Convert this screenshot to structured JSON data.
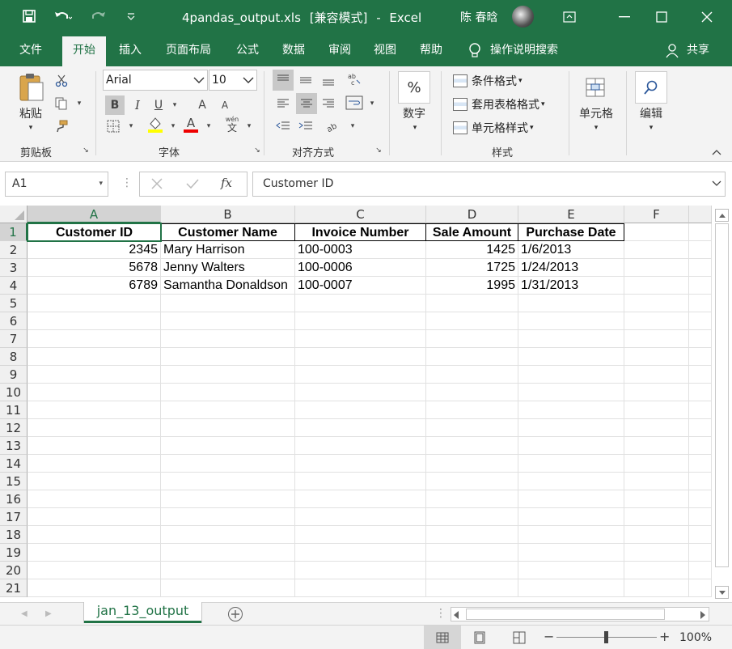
{
  "titlebar": {
    "filename": "4pandas_output.xls",
    "mode": "[兼容模式]",
    "app": "Excel",
    "separator": "-",
    "user": "陈 春晗"
  },
  "tabs": [
    "文件",
    "开始",
    "插入",
    "页面布局",
    "公式",
    "数据",
    "审阅",
    "视图",
    "帮助"
  ],
  "active_tab": "开始",
  "tell_me": "操作说明搜索",
  "share": "共享",
  "ribbon": {
    "clipboard": {
      "paste": "粘贴",
      "label": "剪贴板"
    },
    "font": {
      "name": "Arial",
      "size": "10",
      "label": "字体",
      "bold": "B",
      "italic": "I",
      "underline": "U",
      "grow": "A",
      "shrink": "A",
      "font_color_letter": "A",
      "phonetic": "wén"
    },
    "alignment": {
      "label": "对齐方式"
    },
    "number": {
      "pct": "%",
      "label": "数字"
    },
    "styles": {
      "conditional": "条件格式",
      "table": "套用表格格式",
      "cell": "单元格样式",
      "label": "样式"
    },
    "cells": {
      "label": "单元格"
    },
    "editing": {
      "label": "编辑"
    }
  },
  "formula_bar": {
    "name_box": "A1",
    "content": "Customer ID",
    "fx": "fx"
  },
  "columns": [
    "A",
    "B",
    "C",
    "D",
    "E",
    "F"
  ],
  "rows": [
    "1",
    "2",
    "3",
    "4",
    "5",
    "6",
    "7",
    "8",
    "9",
    "10",
    "11",
    "12",
    "13",
    "14",
    "15",
    "16",
    "17",
    "18",
    "19",
    "20",
    "21"
  ],
  "table": {
    "headers": [
      "Customer ID",
      "Customer Name",
      "Invoice Number",
      "Sale Amount",
      "Purchase Date"
    ],
    "rows": [
      [
        "2345",
        "Mary Harrison",
        "100-0003",
        "1425",
        "1/6/2013"
      ],
      [
        "5678",
        "Jenny Walters",
        "100-0006",
        "1725",
        "1/24/2013"
      ],
      [
        "6789",
        "Samantha Donaldson",
        "100-0007",
        "1995",
        "1/31/2013"
      ]
    ]
  },
  "sheet_tab": "jan_13_output",
  "zoom": "100%",
  "colors": {
    "accent": "#217346",
    "ribbon_bg": "#f3f3f3"
  }
}
